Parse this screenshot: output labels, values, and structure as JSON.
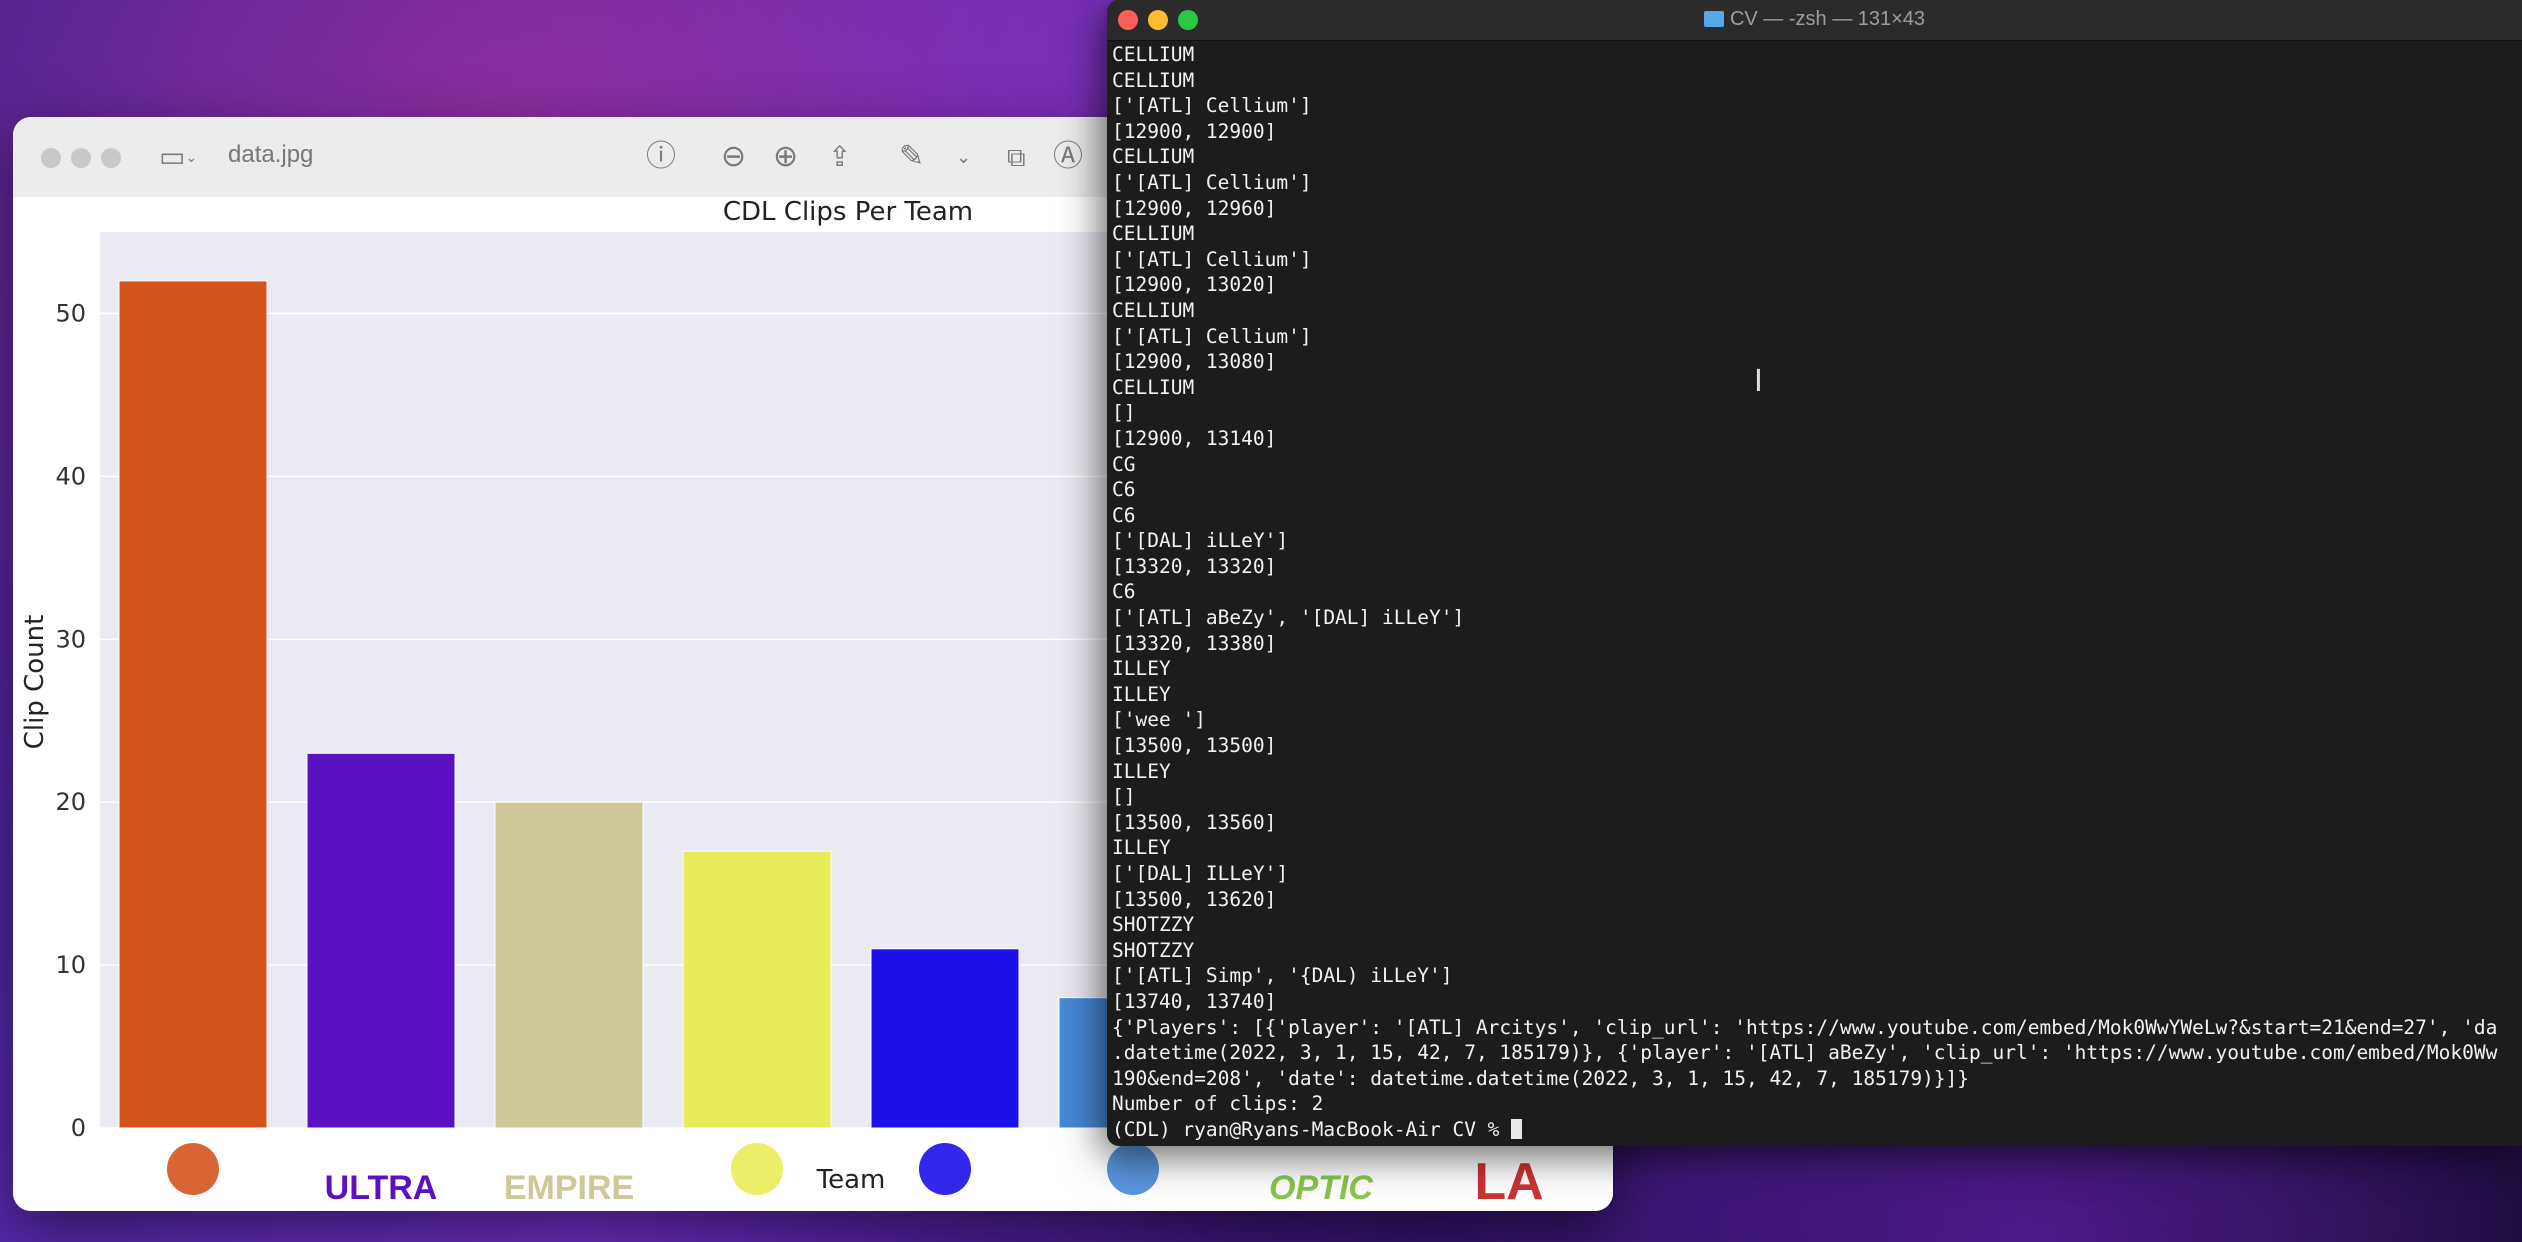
{
  "preview": {
    "filename": "data.jpg",
    "icons": [
      "sidebar-icon",
      "info-icon",
      "zoom-out-icon",
      "zoom-in-icon",
      "share-icon",
      "markup-icon",
      "rotate-icon",
      "annotate-icon"
    ]
  },
  "chart_data": {
    "type": "bar",
    "title": "CDL Clips Per Team",
    "xlabel": "Team",
    "ylabel": "Clip Count",
    "ylim": [
      0,
      55
    ],
    "yticks": [
      0,
      10,
      20,
      30,
      40,
      50
    ],
    "categories": [
      "FaZe / Atlanta logo",
      "Toronto Ultra",
      "Dallas Empire",
      "Florida Mutineers",
      "Minnesota RØKKR",
      "Seattle Surge",
      "OpTic",
      "LA"
    ],
    "category_labels": [
      "",
      "ULTRA",
      "EMPIRE",
      "",
      "",
      "",
      "OPTIC",
      "LA"
    ],
    "values": [
      52,
      23,
      20,
      17,
      11,
      8,
      0,
      0
    ],
    "colors": [
      "#d4541e",
      "#5b10c2",
      "#cec797",
      "#e8ec58",
      "#1d10e8",
      "#4789d8",
      "#88c64a",
      "#cc3333"
    ],
    "grid": true
  },
  "terminal": {
    "title": "CV — -zsh — 131×43",
    "lines": [
      "CELLIUM",
      "CELLIUM",
      "['[ATL] Cellium']",
      "[12900, 12900]",
      "CELLIUM",
      "['[ATL] Cellium']",
      "[12900, 12960]",
      "CELLIUM",
      "['[ATL] Cellium']",
      "[12900, 13020]",
      "CELLIUM",
      "['[ATL] Cellium']",
      "[12900, 13080]",
      "CELLIUM",
      "[]",
      "[12900, 13140]",
      "CG",
      "C6",
      "C6",
      "['[DAL] iLLeY']",
      "[13320, 13320]",
      "C6",
      "['[ATL] aBeZy', '[DAL] iLLeY']",
      "[13320, 13380]",
      "ILLEY",
      "ILLEY",
      "['wee ']",
      "[13500, 13500]",
      "ILLEY",
      "[]",
      "[13500, 13560]",
      "ILLEY",
      "['[DAL] ILLeY']",
      "[13500, 13620]",
      "SHOTZZY",
      "SHOTZZY",
      "['[ATL] Simp', '{DAL) iLLeY']",
      "[13740, 13740]",
      "{'Players': [{'player': '[ATL] Arcitys', 'clip_url': 'https://www.youtube.com/embed/Mok0WwYWeLw?&start=21&end=27', 'da",
      ".datetime(2022, 3, 1, 15, 42, 7, 185179)}, {'player': '[ATL] aBeZy', 'clip_url': 'https://www.youtube.com/embed/Mok0Ww",
      "190&end=208', 'date': datetime.datetime(2022, 3, 1, 15, 42, 7, 185179)}]}",
      "Number of clips: 2"
    ],
    "prompt": "(CDL) ryan@Ryans-MacBook-Air CV % "
  }
}
